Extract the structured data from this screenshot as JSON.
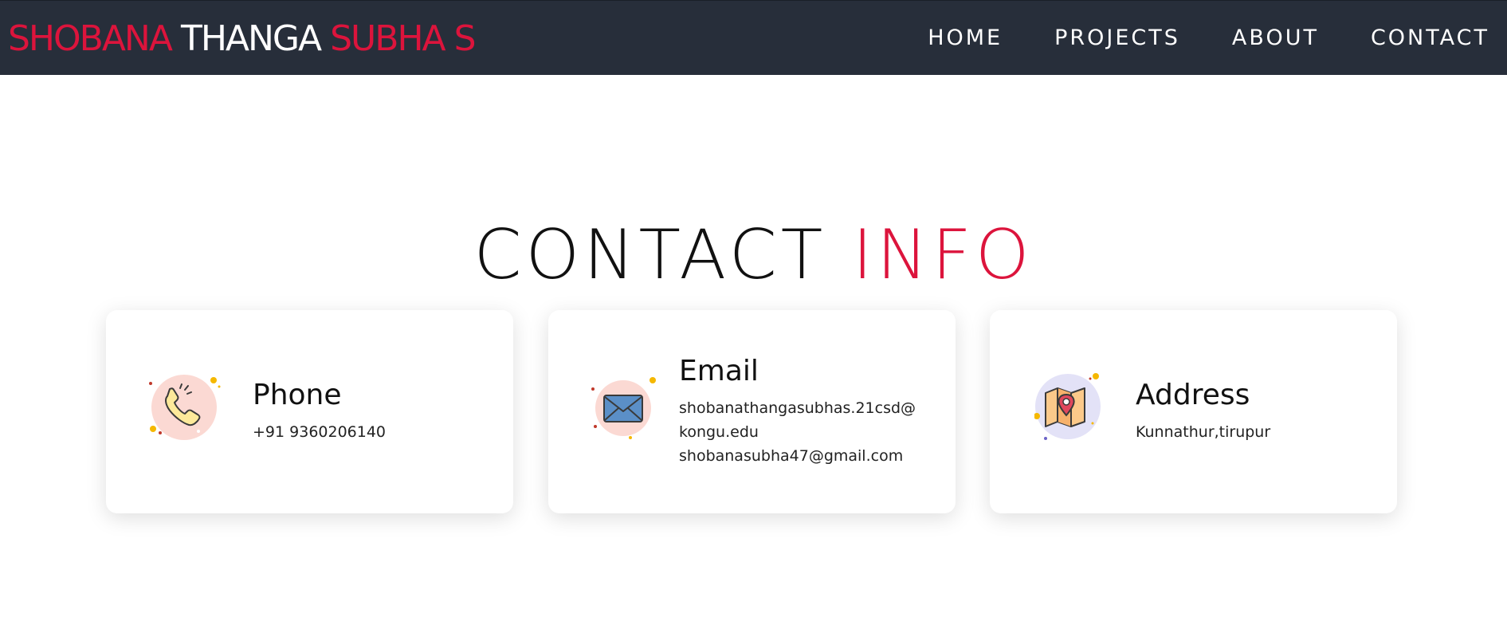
{
  "brand": {
    "part1": "SHOBANA",
    "part2": "THANGA",
    "part3": "SUBHA S"
  },
  "nav": {
    "home": "HOME",
    "projects": "PROJECTS",
    "about": "ABOUT",
    "contact": "CONTACT"
  },
  "section": {
    "title_dark": "CONTACT",
    "title_red": "INFO"
  },
  "cards": {
    "phone": {
      "icon": "phone-icon",
      "title": "Phone",
      "text": "+91 9360206140"
    },
    "email": {
      "icon": "envelope-icon",
      "title": "Email",
      "line1": "shobanathangasubhas.21csd@",
      "line2": "kongu.edu",
      "line3": "shobanasubha47@gmail.com"
    },
    "address": {
      "icon": "map-pin-icon",
      "title": "Address",
      "text": "Kunnathur,tirupur"
    }
  },
  "colors": {
    "accent": "#dc143c",
    "navbar": "#272e3a",
    "background": "#ffffff"
  }
}
